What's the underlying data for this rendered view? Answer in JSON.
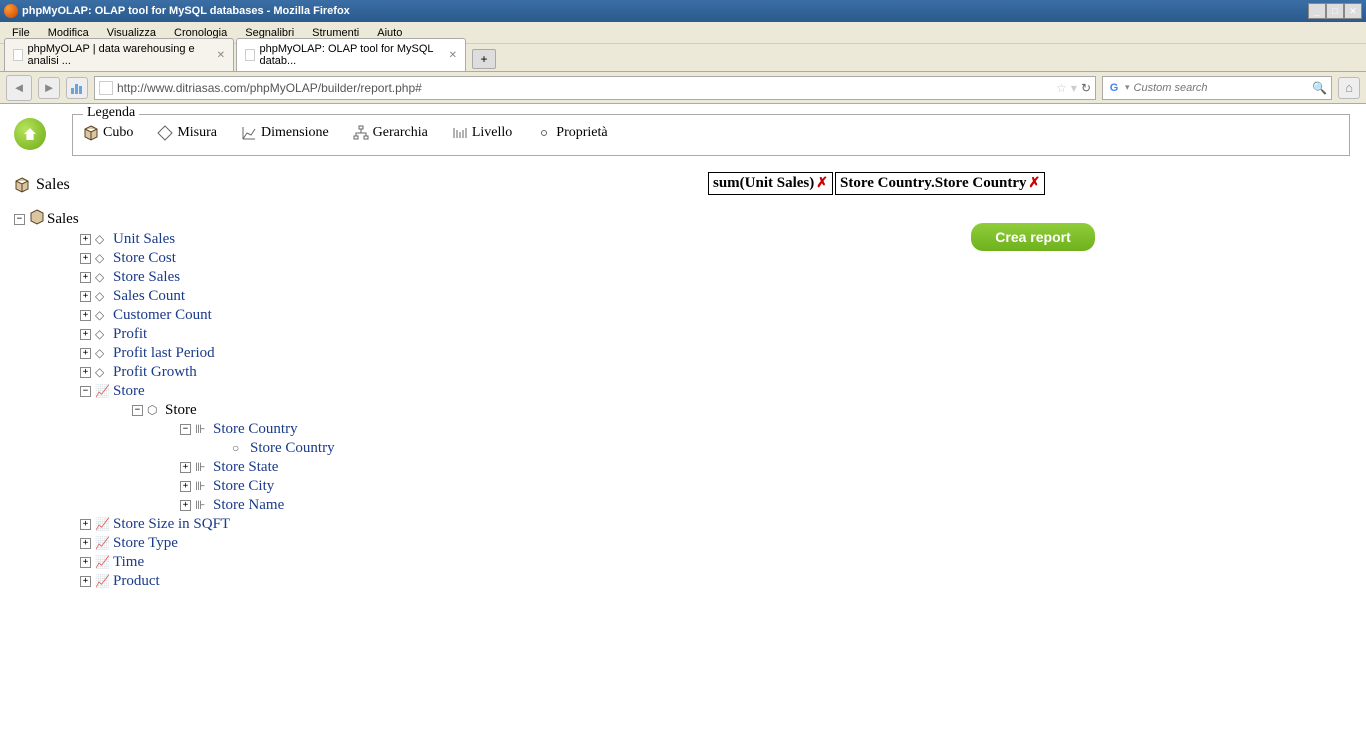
{
  "window": {
    "title": "phpMyOLAP: OLAP tool for MySQL databases - Mozilla Firefox"
  },
  "menu": {
    "items": [
      "File",
      "Modifica",
      "Visualizza",
      "Cronologia",
      "Segnalibri",
      "Strumenti",
      "Aiuto"
    ]
  },
  "tabs": {
    "items": [
      {
        "label": "phpMyOLAP | data warehousing e analisi ..."
      },
      {
        "label": "phpMyOLAP: OLAP tool for MySQL datab..."
      }
    ]
  },
  "url": {
    "value": "http://www.ditriasas.com/phpMyOLAP/builder/report.php#"
  },
  "search": {
    "placeholder": "Custom search"
  },
  "legend": {
    "title": "Legenda",
    "items": [
      {
        "icon": "cube",
        "label": "Cubo"
      },
      {
        "icon": "measure",
        "label": "Misura"
      },
      {
        "icon": "dimension",
        "label": "Dimensione"
      },
      {
        "icon": "hierarchy",
        "label": "Gerarchia"
      },
      {
        "icon": "level",
        "label": "Livello"
      },
      {
        "icon": "property",
        "label": "Proprietà"
      }
    ]
  },
  "cube": {
    "name": "Sales"
  },
  "tree": {
    "root": "Sales",
    "measures": [
      "Unit Sales",
      "Store Cost",
      "Store Sales",
      "Sales Count",
      "Customer Count",
      "Profit",
      "Profit last Period",
      "Profit Growth"
    ],
    "dimensions": {
      "store": {
        "label": "Store",
        "hier": "Store",
        "levels": [
          "Store Country",
          "Store State",
          "Store City",
          "Store Name"
        ],
        "prop": "Store Country"
      },
      "others": [
        "Store Size in SQFT",
        "Store Type",
        "Time",
        "Product"
      ]
    }
  },
  "chips": [
    {
      "label": "sum(Unit Sales)"
    },
    {
      "label": "Store Country.Store Country"
    }
  ],
  "button": {
    "create": "Crea report"
  }
}
